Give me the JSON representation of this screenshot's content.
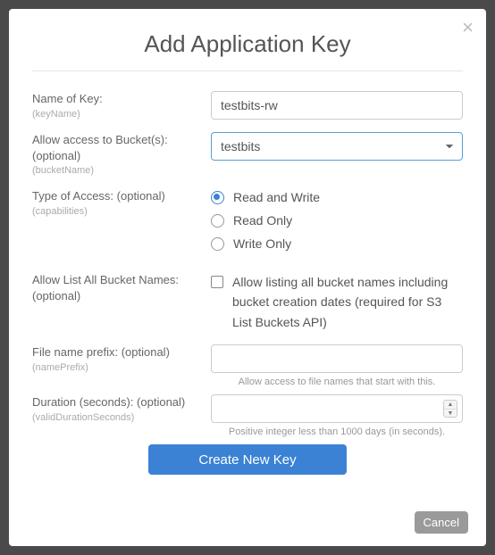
{
  "title": "Add Application Key",
  "fields": {
    "name": {
      "label": "Name of Key:",
      "api": "(keyName)",
      "value": "testbits-rw"
    },
    "bucket": {
      "label": "Allow access to Bucket(s): (optional)",
      "api": "(bucketName)",
      "selected": "testbits"
    },
    "access": {
      "label": "Type of Access: (optional)",
      "api": "(capabilities)",
      "options": {
        "rw": "Read and Write",
        "ro": "Read Only",
        "wo": "Write Only"
      },
      "selected": "rw"
    },
    "list": {
      "label": "Allow List All Bucket Names: (optional)",
      "checkbox_label": "Allow listing all bucket names including bucket creation dates (required for S3 List Buckets API)"
    },
    "prefix": {
      "label": "File name prefix: (optional)",
      "api": "(namePrefix)",
      "value": "",
      "hint": "Allow access to file names that start with this."
    },
    "duration": {
      "label": "Duration (seconds): (optional)",
      "api": "(validDurationSeconds)",
      "value": "",
      "hint": "Positive integer less than 1000 days (in seconds)."
    }
  },
  "buttons": {
    "submit": "Create New Key",
    "cancel": "Cancel"
  }
}
